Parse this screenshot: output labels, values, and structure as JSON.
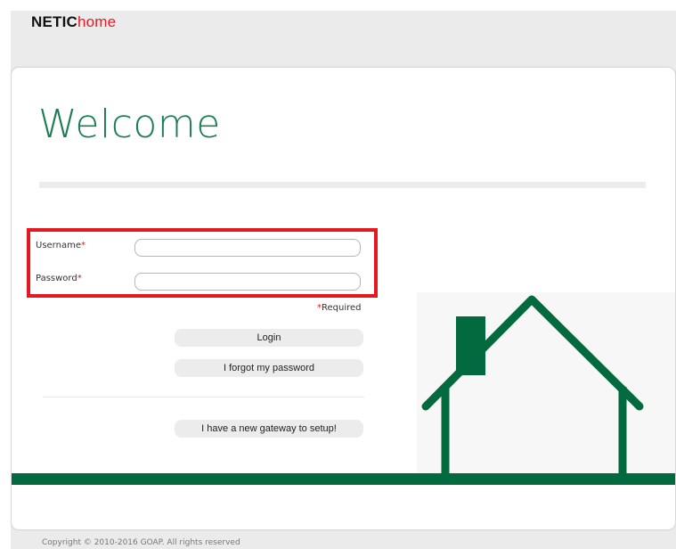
{
  "brand": {
    "part1": "NETIC",
    "part2": "home"
  },
  "welcome": "Welcome",
  "form": {
    "username_label": "Username",
    "password_label": "Password",
    "required_mark": "*",
    "username_value": "",
    "password_value": "",
    "required_note_mark": "*",
    "required_note": "Required"
  },
  "buttons": {
    "login": "Login",
    "forgot": "I forgot my password",
    "gateway": "I have a new gateway to setup!"
  },
  "colors": {
    "brand_green": "#036a3f",
    "accent_red": "#e3191f"
  },
  "footer": {
    "copyright": "Copyright © 2010-2016 GOAP. All rights reserved"
  }
}
